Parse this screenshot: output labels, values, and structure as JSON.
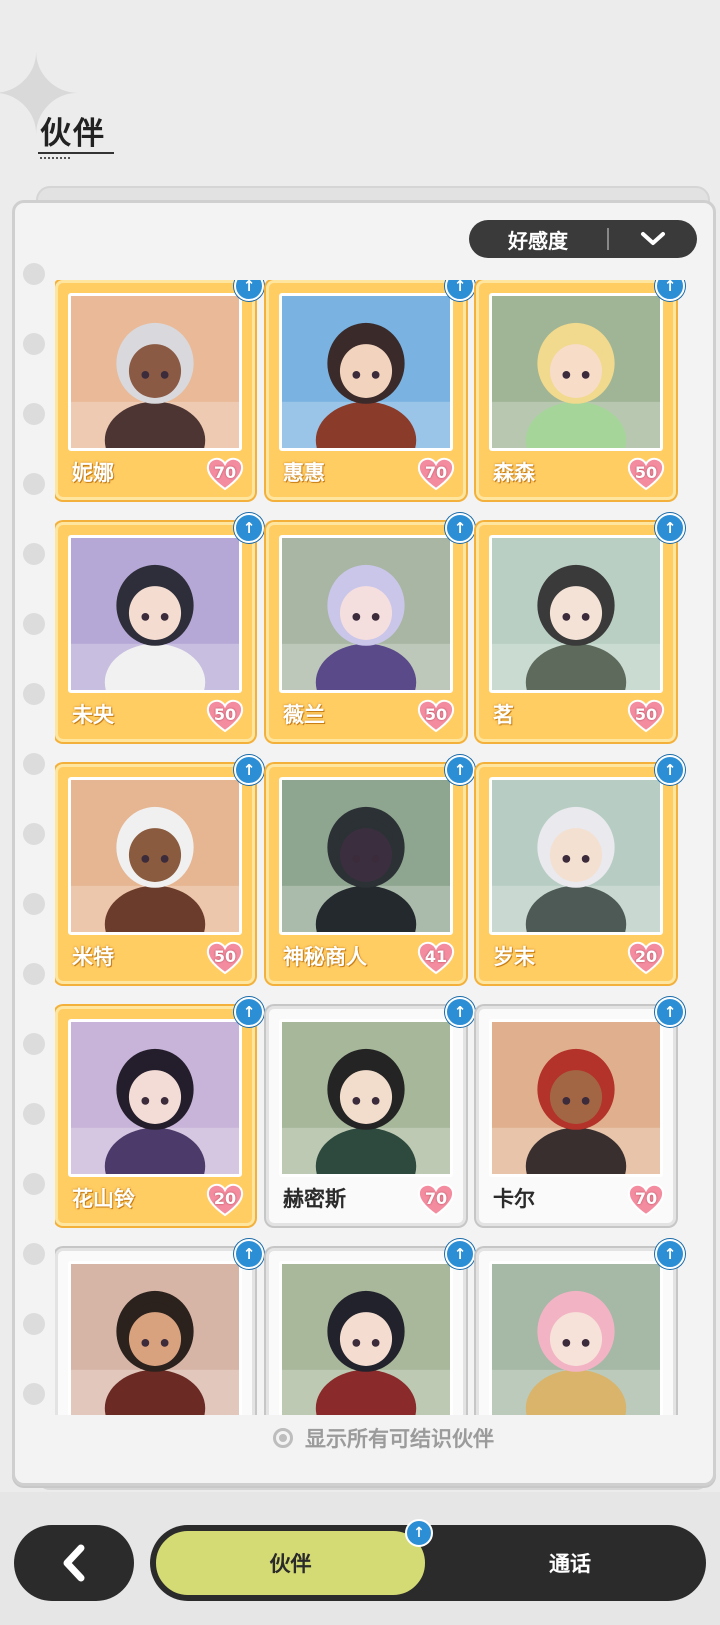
{
  "header": {
    "title": "伙伴"
  },
  "sort": {
    "label": "好感度",
    "icon": "chevron-down-icon"
  },
  "companions": [
    {
      "name": "妮娜",
      "affection": "70",
      "tier": "gold",
      "bg": "#e9b998",
      "hair": "#d9d9dd",
      "skin": "#8a5a44",
      "outfit": "#4c3533"
    },
    {
      "name": "惠惠",
      "affection": "70",
      "tier": "gold",
      "bg": "#7ab2e1",
      "hair": "#3a2a2a",
      "skin": "#f2d3bd",
      "outfit": "#8a3b2a"
    },
    {
      "name": "森森",
      "affection": "50",
      "tier": "gold",
      "bg": "#9fb596",
      "hair": "#f1d98d",
      "skin": "#f7dcc8",
      "outfit": "#a6d59a"
    },
    {
      "name": "未央",
      "affection": "50",
      "tier": "gold",
      "bg": "#b6a8d6",
      "hair": "#2e2e3a",
      "skin": "#f4dcd0",
      "outfit": "#f1f1f1"
    },
    {
      "name": "薇兰",
      "affection": "50",
      "tier": "gold",
      "bg": "#a8b6a3",
      "hair": "#c9c6ea",
      "skin": "#f4dede",
      "outfit": "#5a4a8a"
    },
    {
      "name": "茗",
      "affection": "50",
      "tier": "gold",
      "bg": "#b9cfc3",
      "hair": "#3a3a3a",
      "skin": "#f4e2d6",
      "outfit": "#5e6a5b"
    },
    {
      "name": "米特",
      "affection": "50",
      "tier": "gold",
      "bg": "#e6b591",
      "hair": "#f0f0f0",
      "skin": "#8a5b3e",
      "outfit": "#6b3b2b"
    },
    {
      "name": "神秘商人",
      "affection": "41",
      "tier": "gold",
      "bg": "#8ea58f",
      "hair": "#2b3135",
      "skin": "#3b2f3f",
      "outfit": "#24292d"
    },
    {
      "name": "岁末",
      "affection": "20",
      "tier": "gold",
      "bg": "#b7cdc3",
      "hair": "#e9e9ee",
      "skin": "#f4e0d0",
      "outfit": "#4d5a55"
    },
    {
      "name": "花山铃",
      "affection": "20",
      "tier": "gold",
      "bg": "#c7b4d8",
      "hair": "#241e2c",
      "skin": "#f4dcd6",
      "outfit": "#4c3a6a"
    },
    {
      "name": "赫密斯",
      "affection": "70",
      "tier": "white",
      "bg": "#a7b79a",
      "hair": "#242424",
      "skin": "#f2dccb",
      "outfit": "#2e4a3e"
    },
    {
      "name": "卡尔",
      "affection": "70",
      "tier": "white",
      "bg": "#e0b08e",
      "hair": "#b3322a",
      "skin": "#a36645",
      "outfit": "#3a2f2f"
    },
    {
      "name": "",
      "affection": "",
      "tier": "white",
      "bg": "#d7b5a6",
      "hair": "#2b211d",
      "skin": "#d9a27e",
      "outfit": "#6b2a24"
    },
    {
      "name": "",
      "affection": "",
      "tier": "white",
      "bg": "#a9b79b",
      "hair": "#22222c",
      "skin": "#f4dcd0",
      "outfit": "#8a2a2a"
    },
    {
      "name": "",
      "affection": "",
      "tier": "white",
      "bg": "#a6b8a6",
      "hair": "#f2b4c4",
      "skin": "#f6e2d8",
      "outfit": "#d9b46a"
    }
  ],
  "footer": {
    "show_all_label": "显示所有可结识伙伴"
  },
  "tabs": {
    "active": "伙伴",
    "other": "通话"
  },
  "colors": {
    "gold": "#ffcd62",
    "accent": "#d4da74",
    "badge": "#2c8fd6",
    "heart": "#f48ca0"
  }
}
